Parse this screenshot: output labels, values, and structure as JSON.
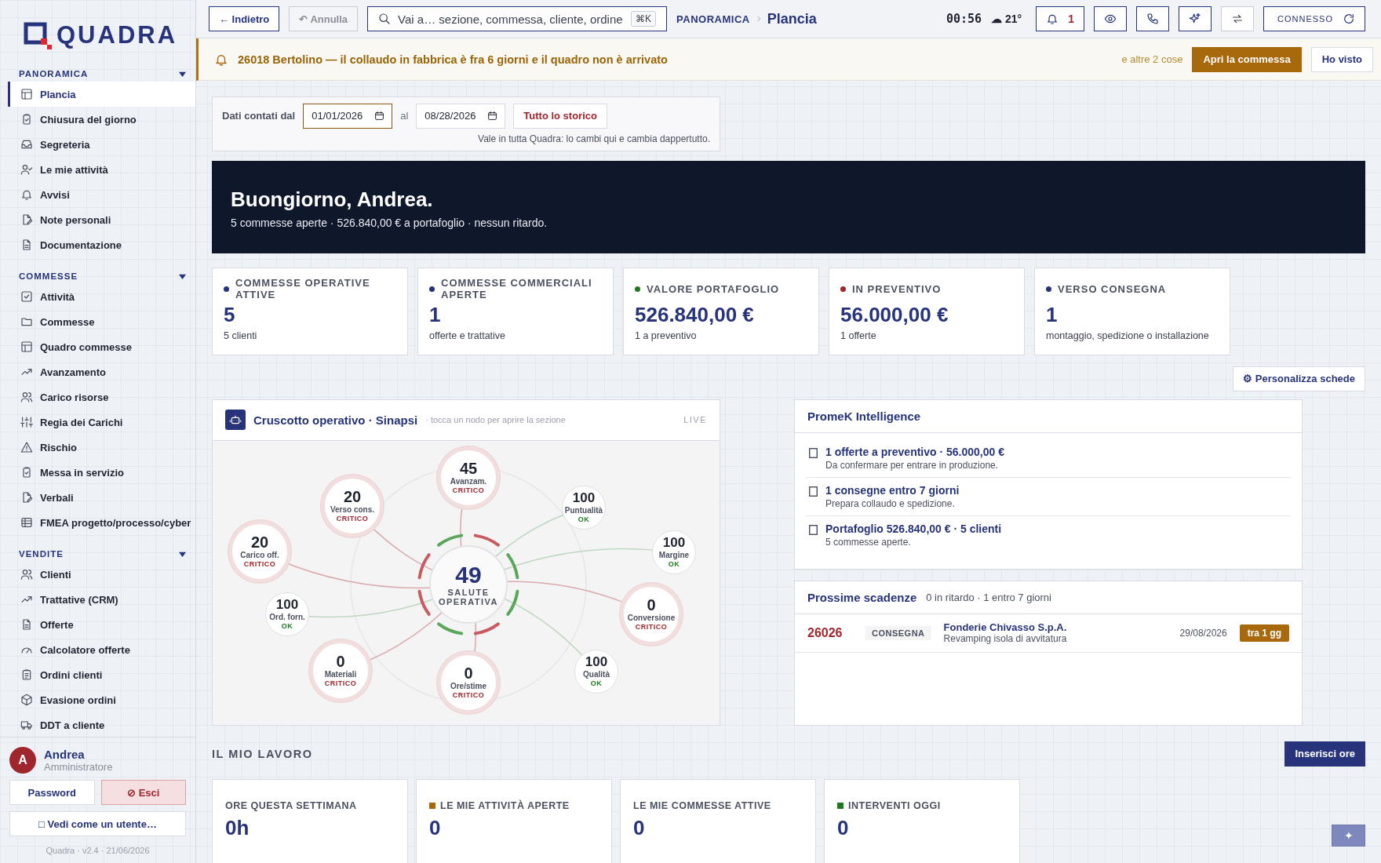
{
  "sidebar": {
    "logo": "QUADRA",
    "sections": [
      {
        "title": "PANORAMICA",
        "expanded": true,
        "items": [
          {
            "label": "Plancia",
            "selected": true
          },
          {
            "label": "Chiusura del giorno",
            "selected": false
          },
          {
            "label": "Segreteria",
            "selected": false
          },
          {
            "label": "Le mie attività",
            "selected": false
          },
          {
            "label": "Avvisi",
            "selected": false
          },
          {
            "label": "Note personali",
            "selected": false
          },
          {
            "label": "Documentazione",
            "selected": false
          }
        ]
      },
      {
        "title": "COMMESSE",
        "expanded": true,
        "items": [
          {
            "label": "Attività",
            "selected": false
          },
          {
            "label": "Commesse",
            "selected": false
          },
          {
            "label": "Quadro commesse",
            "selected": false
          },
          {
            "label": "Avanzamento",
            "selected": false
          },
          {
            "label": "Carico risorse",
            "selected": false
          },
          {
            "label": "Regia dei Carichi",
            "selected": false
          },
          {
            "label": "Rischio",
            "selected": false
          },
          {
            "label": "Messa in servizio",
            "selected": false
          },
          {
            "label": "Verbali",
            "selected": false
          },
          {
            "label": "FMEA progetto/processo/cyber",
            "selected": false
          }
        ]
      },
      {
        "title": "VENDITE",
        "expanded": true,
        "items": [
          {
            "label": "Clienti",
            "selected": false
          },
          {
            "label": "Trattative (CRM)",
            "selected": false
          },
          {
            "label": "Offerte",
            "selected": false
          },
          {
            "label": "Calcolatore offerte",
            "selected": false
          },
          {
            "label": "Ordini clienti",
            "selected": false
          },
          {
            "label": "Evasione ordini",
            "selected": false
          },
          {
            "label": "DDT a cliente",
            "selected": false
          }
        ]
      }
    ],
    "user": {
      "initial": "A",
      "name": "Andrea",
      "role": "Amministratore"
    },
    "actions": [
      {
        "label": "Password",
        "kind": "plain"
      },
      {
        "label": "⊘ Esci",
        "kind": "danger"
      }
    ],
    "view_as": "□ Vedi come un utente…",
    "footer": "Quadra · v2.4 · 21/06/2026"
  },
  "topbar": {
    "back": "← Indietro",
    "undo": "↶ Annulla",
    "search": {
      "placeholder": "Vai a… sezione, commessa, cliente, ordine",
      "shortcut": "⌘K"
    },
    "breadcrumb": {
      "section": "PANORAMICA",
      "page": "Plancia"
    },
    "clock": "00:56",
    "weather": "☁ 21°",
    "notifications": "1",
    "connection": "CONNESSO"
  },
  "alert": {
    "text": "26018 Bertolino — il collaudo in fabbrica è fra 6 giorni e il quadro non è arrivato",
    "more": "e altre 2 cose",
    "buttons": [
      {
        "label": "Apri la commessa",
        "kind": "primary"
      },
      {
        "label": "Ho visto",
        "kind": "plain"
      }
    ]
  },
  "date_filter": {
    "label": "Dati contati dal",
    "from": "01/01/2026",
    "to_label": "al",
    "to": "08/28/2026",
    "button": "Tutto lo storico",
    "note": "Vale in tutta Quadra: lo cambi qui e cambia dappertutto."
  },
  "greeting": {
    "title": "Buongiorno, Andrea.",
    "subtitle": "5 commesse aperte · 526.840,00 € a portafoglio · nessun ritardo."
  },
  "metrics": [
    {
      "label": "COMMESSE OPERATIVE ATTIVE",
      "value": "5",
      "note": "5 clienti",
      "color": "#27337a"
    },
    {
      "label": "COMMESSE COMMERCIALI APERTE",
      "value": "1",
      "note": "offerte e trattative",
      "color": "#27337a"
    },
    {
      "label": "VALORE PORTAFOGLIO",
      "value": "526.840,00 €",
      "note": "1 a preventivo",
      "color": "#1e7a1e"
    },
    {
      "label": "IN PREVENTIVO",
      "value": "56.000,00 €",
      "note": "1 offerte",
      "color": "#a0262e"
    },
    {
      "label": "VERSO CONSEGNA",
      "value": "1",
      "note": "montaggio, spedizione o installazione",
      "color": "#27337a"
    }
  ],
  "customize_button": "⚙ Personalizza schede",
  "dashboard": {
    "title": "Cruscotto operativo · Sinapsi",
    "hint": "· tocca un nodo per aprire la sezione",
    "badge": "LIVE",
    "center": {
      "value": "49",
      "label": "SALUTE OPERATIVA"
    },
    "nodes": [
      {
        "value": "45",
        "label": "Avanzam.",
        "status": "CRITICO",
        "kind": "critical"
      },
      {
        "value": "100",
        "label": "Puntualità",
        "status": "OK",
        "kind": "ok"
      },
      {
        "value": "100",
        "label": "Margine",
        "status": "OK",
        "kind": "ok"
      },
      {
        "value": "0",
        "label": "Conversione",
        "status": "CRITICO",
        "kind": "critical"
      },
      {
        "value": "100",
        "label": "Qualità",
        "status": "OK",
        "kind": "ok"
      },
      {
        "value": "0",
        "label": "Ore/stime",
        "status": "CRITICO",
        "kind": "critical"
      },
      {
        "value": "0",
        "label": "Materiali",
        "status": "CRITICO",
        "kind": "critical"
      },
      {
        "value": "100",
        "label": "Ord. forn.",
        "status": "OK",
        "kind": "ok"
      },
      {
        "value": "20",
        "label": "Carico off.",
        "status": "CRITICO",
        "kind": "critical"
      },
      {
        "value": "20",
        "label": "Verso cons.",
        "status": "CRITICO",
        "kind": "critical"
      }
    ]
  },
  "intelligence": {
    "title": "PromeK Intelligence",
    "items": [
      {
        "title": "1 offerte a preventivo · 56.000,00 €",
        "text": "Da confermare per entrare in produzione."
      },
      {
        "title": "1 consegne entro 7 giorni",
        "text": "Prepara collaudo e spedizione."
      },
      {
        "title": "Portafoglio 526.840,00 € · 5 clienti",
        "text": "5 commesse aperte."
      }
    ]
  },
  "deadlines": {
    "title": "Prossime scadenze",
    "summary": "0 in ritardo · 1 entro 7 giorni",
    "rows": [
      {
        "code": "26026",
        "type": "CONSEGNA",
        "client": "Fonderie Chivasso S.p.A.",
        "description": "Revamping isola di avvitatura",
        "date": "29/08/2026",
        "badge": "tra 1 gg"
      }
    ]
  },
  "my_work": {
    "title": "IL MIO LAVORO",
    "button": "Inserisci ore",
    "cards": [
      {
        "label": "ORE QUESTA SETTIMANA",
        "value": "0h"
      },
      {
        "label": "LE MIE ATTIVITÀ APERTE",
        "value": "0",
        "color": "#a8680c"
      },
      {
        "label": "LE MIE COMMESSE ATTIVE",
        "value": "0"
      },
      {
        "label": "INTERVENTI OGGI",
        "value": "0",
        "color": "#1e7a1e"
      }
    ]
  },
  "fab": "✦"
}
